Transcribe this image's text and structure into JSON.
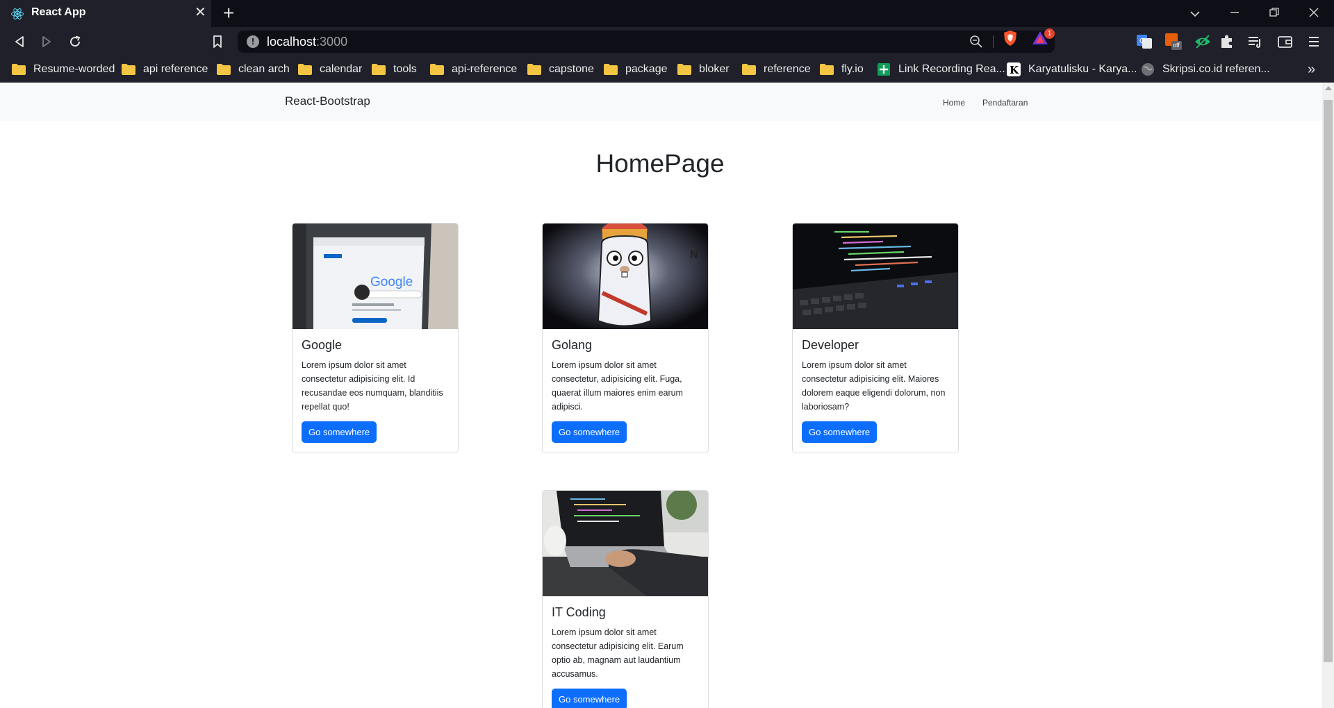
{
  "browser": {
    "tab_title": "React App",
    "url_host": "localhost",
    "url_port": ":3000",
    "rewards_badge": "1",
    "bookmarks": [
      {
        "label": "Resume-worded",
        "type": "folder"
      },
      {
        "label": "api reference",
        "type": "folder"
      },
      {
        "label": "clean arch",
        "type": "folder"
      },
      {
        "label": "calendar",
        "type": "folder"
      },
      {
        "label": "tools",
        "type": "folder"
      },
      {
        "label": "api-reference",
        "type": "folder"
      },
      {
        "label": "capstone",
        "type": "folder"
      },
      {
        "label": "package",
        "type": "folder"
      },
      {
        "label": "bloker",
        "type": "folder"
      },
      {
        "label": "reference",
        "type": "folder"
      },
      {
        "label": "fly.io",
        "type": "folder"
      },
      {
        "label": "Link Recording Rea...",
        "type": "sheets-icon"
      },
      {
        "label": "Karyatulisku - Karya...",
        "type": "k-icon"
      },
      {
        "label": "Skripsi.co.id referen...",
        "type": "globe-icon"
      }
    ],
    "ext_badge_off": "off"
  },
  "navbar": {
    "brand": "React-Bootstrap",
    "links": [
      "Home",
      "Pendaftaran"
    ]
  },
  "page": {
    "title": "HomePage"
  },
  "cards": [
    {
      "title": "Google",
      "text": "Lorem ipsum dolor sit amet consectetur adipisicing elit. Id recusandae eos numquam, blanditiis repellat quo!",
      "button": "Go somewhere",
      "image": "laptop-google-photo",
      "image_text": "Google"
    },
    {
      "title": "Golang",
      "text": "Lorem ipsum dolor sit amet consectetur, adipisicing elit. Fuga, quaerat illum maiores enim earum adipisci.",
      "button": "Go somewhere",
      "image": "golang-gopher-photo"
    },
    {
      "title": "Developer",
      "text": "Lorem ipsum dolor sit amet consectetur adipisicing elit. Maiores dolorem eaque eligendi dolorum, non laboriosam?",
      "button": "Go somewhere",
      "image": "laptop-code-keyboard-photo"
    },
    {
      "title": "IT Coding",
      "text": "Lorem ipsum dolor sit amet consectetur adipisicing elit. Earum optio ab, magnam aut laudantium accusamus.",
      "button": "Go somewhere",
      "image": "hands-typing-laptop-photo"
    }
  ],
  "colors": {
    "primary_button": "#0d6efd",
    "navbar_bg": "#f8f9fa",
    "chrome_bg": "#1f2029",
    "tabstrip_bg": "#0e0e17"
  }
}
